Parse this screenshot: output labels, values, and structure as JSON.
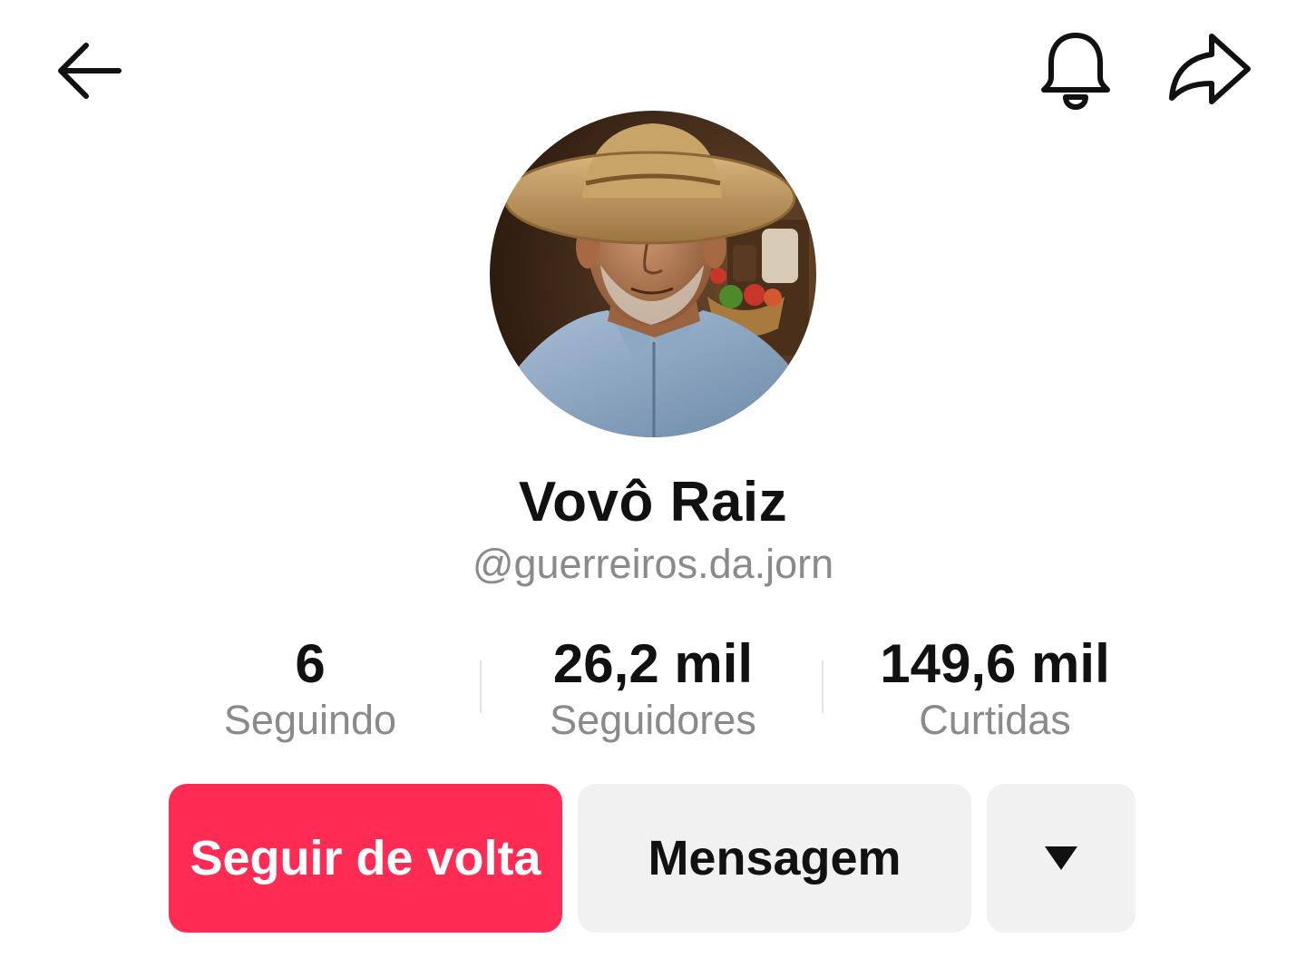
{
  "header": {
    "back_icon": "arrow-left-icon",
    "notification_icon": "bell-icon",
    "share_icon": "share-arrow-icon"
  },
  "profile": {
    "display_name": "Vovô Raiz",
    "username": "@guerreiros.da.jorn"
  },
  "stats": [
    {
      "value": "6",
      "label": "Seguindo"
    },
    {
      "value": "26,2 mil",
      "label": "Seguidores"
    },
    {
      "value": "149,6 mil",
      "label": "Curtidas"
    }
  ],
  "actions": {
    "follow_back_label": "Seguir de volta",
    "message_label": "Mensagem",
    "more_icon": "caret-down-icon"
  },
  "colors": {
    "accent": "#fe2c55",
    "secondary_button": "#f1f1f2",
    "muted_text": "#8a8a8a"
  }
}
